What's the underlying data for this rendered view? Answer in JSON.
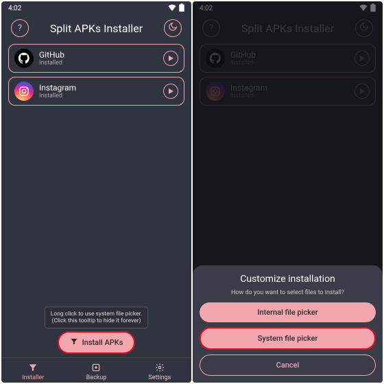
{
  "status": {
    "time": "4:02"
  },
  "header": {
    "title": "Split APKs Installer"
  },
  "apps": [
    {
      "name": "GitHub",
      "status": "Installed"
    },
    {
      "name": "Instagram",
      "status": "Installed"
    }
  ],
  "tooltip": {
    "line1": "Long click to use system file picker.",
    "line2": "(Click this tooltip to hide it forever)"
  },
  "fab": {
    "label": "Install APKs"
  },
  "nav": {
    "installer": "Installer",
    "backup": "Backup",
    "settings": "Settings"
  },
  "sheet": {
    "title": "Customize installation",
    "sub": "How do you want to select files to install?",
    "btn_internal": "Internal file picker",
    "btn_system": "System file picker",
    "btn_cancel": "Cancel"
  }
}
